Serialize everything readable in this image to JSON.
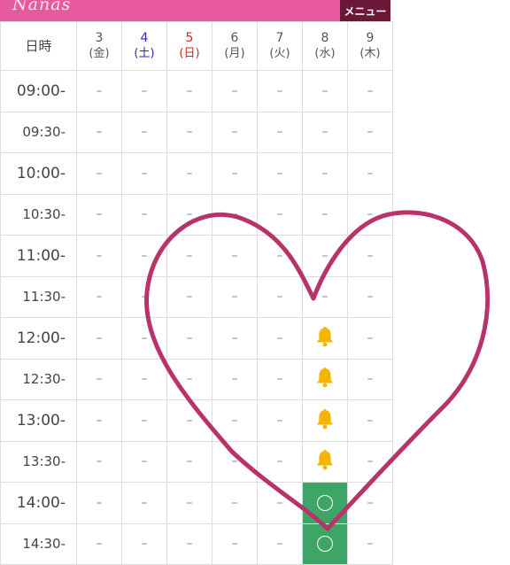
{
  "header": {
    "logo_text": "Nanas",
    "menu_label": "メニュー"
  },
  "schedule": {
    "corner_label": "日時",
    "days": [
      {
        "date": "3",
        "dow": "(金)",
        "type": "weekday"
      },
      {
        "date": "4",
        "dow": "(土)",
        "type": "sat"
      },
      {
        "date": "5",
        "dow": "(日)",
        "type": "sun"
      },
      {
        "date": "6",
        "dow": "(月)",
        "type": "weekday"
      },
      {
        "date": "7",
        "dow": "(火)",
        "type": "weekday"
      },
      {
        "date": "8",
        "dow": "(水)",
        "type": "weekday"
      },
      {
        "date": "9",
        "dow": "(木)",
        "type": "weekday"
      }
    ],
    "rows": [
      {
        "time": "09:00-",
        "cells": [
          "–",
          "–",
          "–",
          "–",
          "–",
          "–",
          "–"
        ]
      },
      {
        "time": "09:30-",
        "cells": [
          "–",
          "–",
          "–",
          "–",
          "–",
          "–",
          "–"
        ]
      },
      {
        "time": "10:00-",
        "cells": [
          "–",
          "–",
          "–",
          "–",
          "–",
          "–",
          "–"
        ]
      },
      {
        "time": "10:30-",
        "cells": [
          "–",
          "–",
          "–",
          "–",
          "–",
          "–",
          "–"
        ]
      },
      {
        "time": "11:00-",
        "cells": [
          "–",
          "–",
          "–",
          "–",
          "–",
          "–",
          "–"
        ]
      },
      {
        "time": "11:30-",
        "cells": [
          "–",
          "–",
          "–",
          "–",
          "–",
          "–",
          "–"
        ]
      },
      {
        "time": "12:00-",
        "cells": [
          "–",
          "–",
          "–",
          "–",
          "–",
          "bell",
          "–"
        ]
      },
      {
        "time": "12:30-",
        "cells": [
          "–",
          "–",
          "–",
          "–",
          "–",
          "bell",
          "–"
        ]
      },
      {
        "time": "13:00-",
        "cells": [
          "–",
          "–",
          "–",
          "–",
          "–",
          "bell",
          "–"
        ]
      },
      {
        "time": "13:30-",
        "cells": [
          "–",
          "–",
          "–",
          "–",
          "–",
          "bell",
          "–"
        ]
      },
      {
        "time": "14:00-",
        "cells": [
          "–",
          "–",
          "–",
          "–",
          "–",
          "open",
          "–"
        ]
      },
      {
        "time": "14:30-",
        "cells": [
          "–",
          "–",
          "–",
          "–",
          "–",
          "open",
          "–"
        ]
      }
    ]
  },
  "colors": {
    "header_bg": "#e75a9e",
    "menu_bg": "#6b1838",
    "bell": "#f5b400",
    "open_bg": "#3fa566",
    "heart_stroke": "#b8336a"
  },
  "icons": {
    "bell": "bell-icon",
    "open": "circle-icon",
    "overlay": "heart-drawing"
  }
}
